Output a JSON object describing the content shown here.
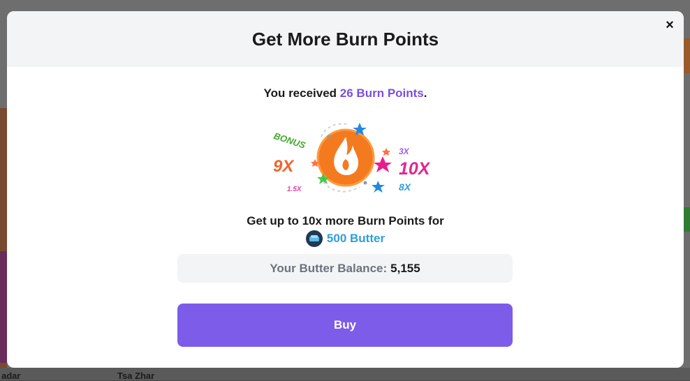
{
  "background": {
    "bottom_labels": [
      "adar",
      "Tsa Zhar"
    ]
  },
  "modal": {
    "title": "Get More Burn Points",
    "close_symbol": "×",
    "received_prefix": "You received ",
    "received_highlight": "26 Burn Points",
    "received_suffix": ".",
    "illustration": {
      "labels": [
        "BONUS",
        "9X",
        "1.5X",
        "3X",
        "10X",
        "8X"
      ]
    },
    "offer_text": "Get up to 10x more Burn Points for",
    "price_text": "500 Butter",
    "balance_label": "Your Butter Balance:",
    "balance_value": "5,155",
    "buy_label": "Buy"
  },
  "colors": {
    "accent_purple": "#7c5ce8",
    "highlight_purple": "#7b4de0",
    "butter_blue": "#2e9fd6",
    "flame_orange": "#f47a1f"
  }
}
